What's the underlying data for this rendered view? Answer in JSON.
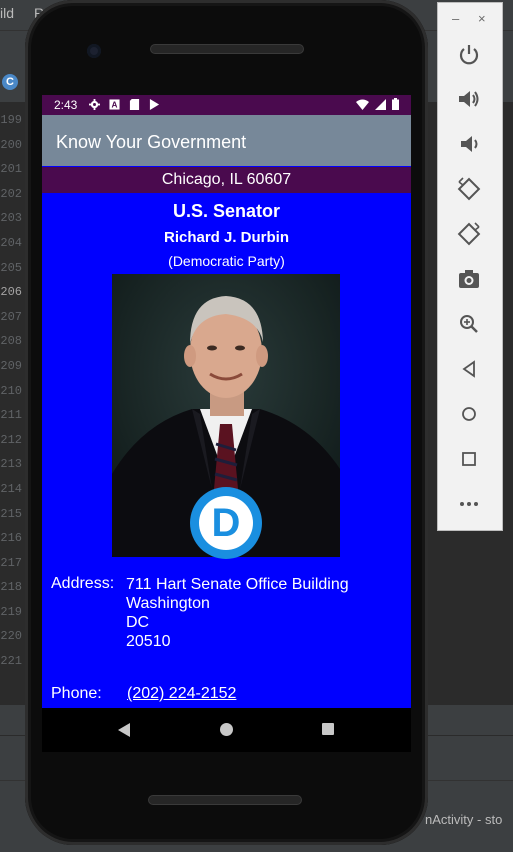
{
  "ide": {
    "menu_left": "ild",
    "menu_second": "R",
    "line_numbers": [
      "199",
      "200",
      "201",
      "202",
      "203",
      "204",
      "205",
      "206",
      "207",
      "208",
      "209",
      "210",
      "211",
      "212",
      "213",
      "214",
      "215",
      "216",
      "217",
      "218",
      "219",
      "220",
      "221"
    ],
    "current_line": "206",
    "status_text": "nActivity - sto"
  },
  "status_bar": {
    "time": "2:43",
    "icons": [
      "gear-icon",
      "a-box-icon",
      "sd-card-icon",
      "play-store-icon"
    ],
    "right_icons": [
      "wifi-icon",
      "signal-icon",
      "battery-icon"
    ]
  },
  "app": {
    "title": "Know Your Government",
    "location": "Chicago, IL 60607",
    "office": "U.S. Senator",
    "official_name": "Richard J. Durbin",
    "party": "(Democratic Party)",
    "party_logo_letter": "D",
    "address_label": "Address:",
    "address_lines": [
      "711 Hart Senate Office Building",
      "Washington",
      "DC",
      "20510"
    ],
    "phone_label": "Phone:",
    "phone_number": "(202) 224-2152",
    "colors": {
      "background": "#0000ff",
      "app_bar": "#778899",
      "status_bar": "#4a0a4e",
      "party_logo": "#1a8fe0"
    }
  },
  "emulator_panel": {
    "top": [
      "minimize-icon",
      "close-icon"
    ],
    "minimize_glyph": "–",
    "close_glyph": "×",
    "buttons": [
      "power-icon",
      "volume-up-icon",
      "volume-down-icon",
      "rotate-left-icon",
      "rotate-right-icon",
      "camera-icon",
      "zoom-icon",
      "back-icon",
      "home-icon",
      "overview-icon",
      "more-icon"
    ]
  }
}
